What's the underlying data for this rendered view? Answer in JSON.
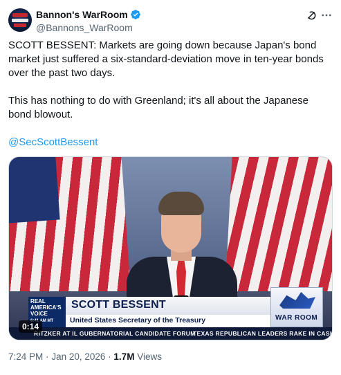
{
  "author": {
    "display_name": "Bannon's WarRoom",
    "handle": "@Bannons_WarRoom",
    "verified": true,
    "verified_color": "#1d9bf0"
  },
  "header_icons": [
    "grok-icon",
    "more-icon"
  ],
  "tweet": {
    "paragraph1": "SCOTT BESSENT: Markets are going down because Japan's bond market just suffered a six-standard-deviation move in ten-year bonds over the past two days.",
    "paragraph2": "This has nothing to do with Greenland; it's all about the Japanese bond blowout.",
    "mention": "@SecScottBessent",
    "mention_color": "#1d9bf0"
  },
  "video": {
    "elapsed": "0:14",
    "chyron_name": "SCOTT BESSENT",
    "chyron_title": "United States Secretary of the Treasury",
    "network_logo_line1": "REAL",
    "network_logo_line2": "AMERICA'S",
    "network_logo_line3": "VOICE",
    "network_logo_time": "6:41 AM MT",
    "show_logo": "WAR ROOM",
    "ticker_left": "RITZKER AT IL GUBERNATORIAL CANDIDATE FORUM",
    "ticker_right": "TEXAS REPUBLICAN LEADERS RAKE IN CASH,"
  },
  "meta": {
    "time": "7:24 PM",
    "separator": "·",
    "date": "Jan 20, 2026",
    "views_count": "1.7M",
    "views_label": "Views"
  }
}
